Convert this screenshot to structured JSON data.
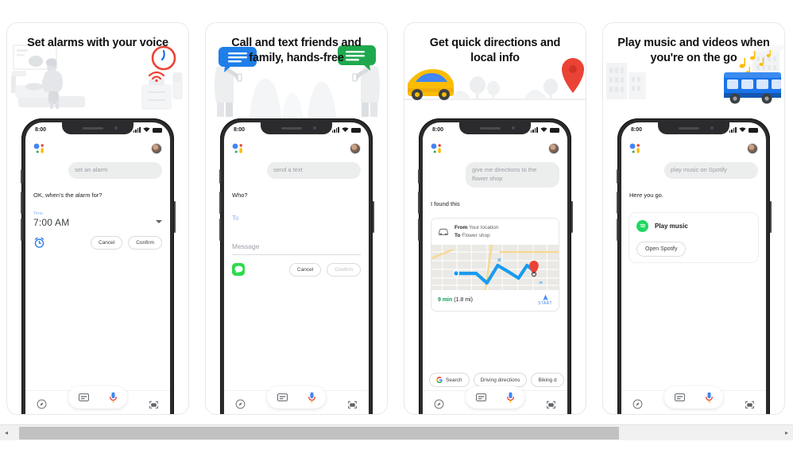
{
  "cards": [
    {
      "headline": "Set alarms with your voice",
      "illustration": "bedroom-alarm-clock-illustration",
      "phone": {
        "status": {
          "time": "8:00",
          "signal": "signal-bars-icon",
          "wifi": "wifi-icon",
          "battery": "battery-icon"
        },
        "assistant_icon": "google-assistant-dots-icon",
        "avatar": "user-avatar",
        "user_bubble": "set an alarm",
        "assistant_reply": "OK, when's the alarm for?",
        "form": {
          "field_label": "Time",
          "field_value": "7:00 AM",
          "dropdown_icon": "chevron-down-icon",
          "leading_icon": "alarm-clock-icon",
          "cancel": "Cancel",
          "confirm": "Confirm",
          "confirm_disabled": false
        },
        "nav": {
          "left": "explore-icon",
          "keyboard": "keyboard-icon",
          "mic": "microphone-icon",
          "right": "lens-icon"
        }
      }
    },
    {
      "headline": "Call and text friends and family, hands-free",
      "illustration": "two-people-texting-illustration",
      "phone": {
        "status": {
          "time": "8:00",
          "signal": "signal-bars-icon",
          "wifi": "wifi-icon",
          "battery": "battery-icon"
        },
        "assistant_icon": "google-assistant-dots-icon",
        "avatar": "user-avatar",
        "user_bubble": "send a text",
        "assistant_reply": "Who?",
        "form": {
          "to_label": "To",
          "message_placeholder": "Message",
          "leading_icon": "messages-app-icon",
          "cancel": "Cancel",
          "confirm": "Confirm",
          "confirm_disabled": true
        },
        "nav": {
          "left": "explore-icon",
          "keyboard": "keyboard-icon",
          "mic": "microphone-icon",
          "right": "lens-icon"
        }
      }
    },
    {
      "headline": "Get quick directions and local info",
      "illustration": "car-driving-to-map-pin-illustration",
      "phone": {
        "status": {
          "time": "8:00",
          "signal": "signal-bars-icon",
          "wifi": "wifi-icon",
          "battery": "battery-icon"
        },
        "assistant_icon": "google-assistant-dots-icon",
        "avatar": "user-avatar",
        "user_bubble": "give me directions to the flower shop",
        "assistant_reply": "I found this",
        "directions": {
          "mode_icon": "car-icon",
          "from_label": "From",
          "from_value": "Your location",
          "to_label": "To",
          "to_value": "Flower shop",
          "map": "route-map",
          "duration": "9 min",
          "distance": "(1.8 mi)",
          "start_icon": "navigation-arrow-icon",
          "start_label": "START"
        },
        "chips": [
          {
            "icon": "google-g-icon",
            "label": "Search"
          },
          {
            "icon": "",
            "label": "Driving directions"
          },
          {
            "icon": "",
            "label": "Biking d"
          }
        ],
        "nav": {
          "left": "explore-icon",
          "keyboard": "keyboard-icon",
          "mic": "microphone-icon",
          "right": "lens-icon"
        }
      }
    },
    {
      "headline": "Play music and videos when you're on the go",
      "illustration": "bus-with-music-notes-illustration",
      "phone": {
        "status": {
          "time": "8:00",
          "signal": "signal-bars-icon",
          "wifi": "wifi-icon",
          "battery": "battery-icon"
        },
        "assistant_icon": "google-assistant-dots-icon",
        "avatar": "user-avatar",
        "user_bubble": "play music on Spotify",
        "assistant_reply": "Here you go.",
        "spotify": {
          "logo": "spotify-icon",
          "title": "Play music",
          "action": "Open Spotify"
        },
        "nav": {
          "left": "explore-icon",
          "keyboard": "keyboard-icon",
          "mic": "microphone-icon",
          "right": "lens-icon"
        }
      }
    }
  ],
  "scrollbar": {
    "left_arrow": "◂",
    "right_arrow": "▸"
  },
  "colors": {
    "google_blue": "#4285f4",
    "google_red": "#ea4335",
    "google_yellow": "#fbbc05",
    "google_green": "#34a853",
    "spotify_green": "#1ed760",
    "messages_green": "#2ddb4b",
    "eta_green": "#0f9d58",
    "route_blue": "#1a9bf0",
    "pin_red": "#ea4335",
    "bubble_gray": "#eceded"
  }
}
